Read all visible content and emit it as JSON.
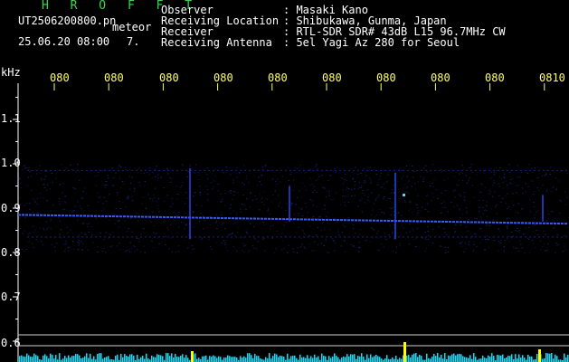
{
  "header": {
    "title": "H R O F F T",
    "file": "UT2506200800.pn",
    "mode": "meteor",
    "datetime": "25.06.20 08:00",
    "count": "7."
  },
  "info": [
    {
      "label": "Observer",
      "value": ": Masaki Kano"
    },
    {
      "label": "Receiving Location",
      "value": ": Shibukawa, Gunma, Japan"
    },
    {
      "label": "Receiver",
      "value": ": RTL-SDR SDR# 43dB L15 96.7MHz CW"
    },
    {
      "label": "Receiving Antenna",
      "value": ": 5el Yagi Az 280 for Seoul"
    }
  ],
  "chart_data": {
    "type": "heatmap",
    "ylabel": "kHz",
    "y_ticks": [
      "1.1",
      "1.0",
      "0.9",
      "0.8",
      "0.7",
      "0.6"
    ],
    "x_ticks": [
      "080",
      "080",
      "080",
      "080",
      "080",
      "080",
      "080",
      "080",
      "080",
      "0810"
    ],
    "ylim": [
      0.6,
      1.15
    ],
    "carrier_khz": [
      0.885,
      0.865
    ],
    "colors": {
      "background": "#000000",
      "trace": "#3a5bff",
      "tick_text": "#ffff66",
      "label_text": "#ffffff",
      "amplitude": "#00e5ff",
      "peak": "#ffff00"
    }
  }
}
